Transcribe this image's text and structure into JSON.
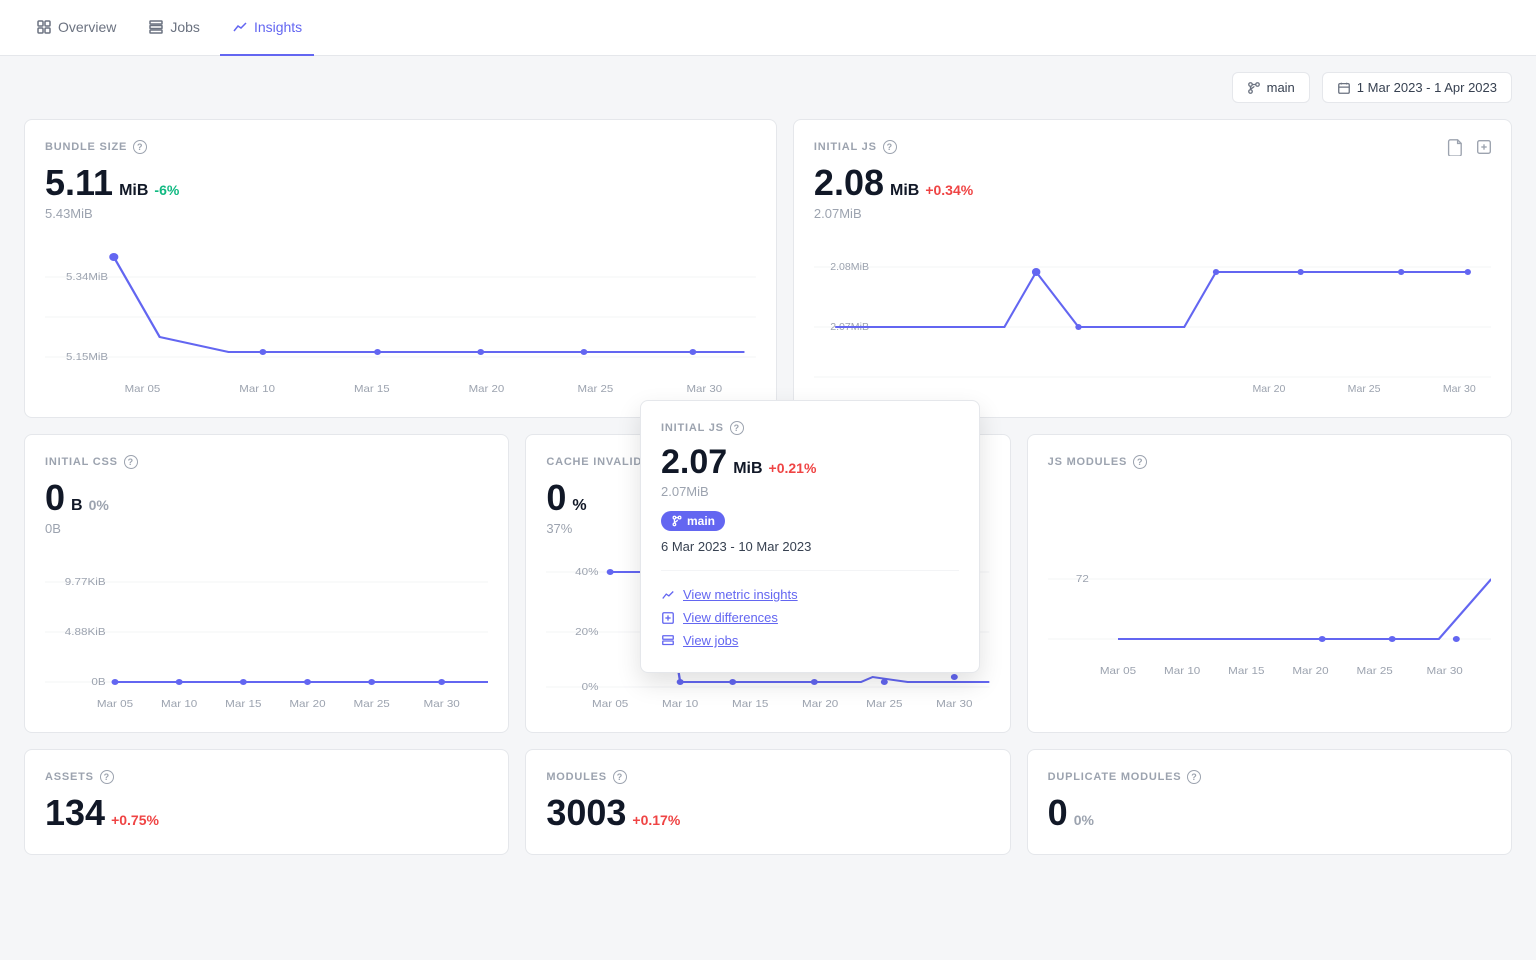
{
  "nav": {
    "items": [
      {
        "id": "overview",
        "label": "Overview",
        "active": false,
        "icon": "grid"
      },
      {
        "id": "jobs",
        "label": "Jobs",
        "active": false,
        "icon": "list"
      },
      {
        "id": "insights",
        "label": "Insights",
        "active": true,
        "icon": "chart-line"
      }
    ]
  },
  "toolbar": {
    "branch": "main",
    "date_range": "1 Mar 2023 - 1 Apr 2023"
  },
  "cards": {
    "bundle_size": {
      "label": "BUNDLE SIZE",
      "value": "5.11",
      "unit": "MiB",
      "change": "-6%",
      "change_type": "negative",
      "prev": "5.43MiB",
      "y_labels": [
        "5.34MiB",
        "5.15MiB"
      ],
      "x_labels": [
        "Mar 05",
        "Mar 10",
        "Mar 15",
        "Mar 20",
        "Mar 25",
        "Mar 30"
      ]
    },
    "initial_js": {
      "label": "INITIAL JS",
      "value": "2.08",
      "unit": "MiB",
      "change": "+0.34%",
      "change_type": "positive",
      "prev": "2.07MiB",
      "y_labels": [
        "2.08MiB",
        "2.07MiB"
      ],
      "x_labels": [
        "Mar 20",
        "Mar 25",
        "Mar 30"
      ]
    },
    "initial_css": {
      "label": "INITIAL CSS",
      "value": "0",
      "unit": "B",
      "change": "0%",
      "change_type": "neutral",
      "prev": "0B",
      "y_labels": [
        "9.77KiB",
        "4.88KiB",
        "0B"
      ],
      "x_labels": [
        "Mar 05",
        "Mar 10",
        "Mar 15",
        "Mar 20",
        "Mar 25",
        "Mar 30"
      ]
    },
    "cache_invalidation": {
      "label": "CACHE INVALIDATION",
      "value": "0",
      "unit": "%",
      "change": "",
      "change_type": "neutral",
      "prev": "37%",
      "y_labels": [
        "40%",
        "20%",
        "0%"
      ],
      "x_labels": [
        "Mar 05",
        "Mar 10",
        "Mar 15",
        "Mar 20",
        "Mar 25",
        "Mar 30"
      ]
    },
    "js_modules": {
      "label": "JS MODULES",
      "value": "",
      "unit": "",
      "change": "",
      "change_type": "neutral",
      "prev": "",
      "y_labels": [
        "72"
      ],
      "x_labels": [
        "Mar 05",
        "Mar 10",
        "Mar 15",
        "Mar 20",
        "Mar 25",
        "Mar 30"
      ]
    },
    "assets": {
      "label": "ASSETS",
      "value": "134",
      "unit": "",
      "change": "+0.75%",
      "change_type": "positive",
      "prev": ""
    },
    "modules": {
      "label": "MODULES",
      "value": "3003",
      "unit": "",
      "change": "+0.17%",
      "change_type": "positive",
      "prev": ""
    },
    "duplicate_modules": {
      "label": "DUPLICATE MODULES",
      "value": "0",
      "unit": "",
      "change": "0%",
      "change_type": "neutral",
      "prev": ""
    }
  },
  "tooltip": {
    "title": "INITIAL JS",
    "value": "2.07",
    "unit": "MiB",
    "change": "+0.21%",
    "change_type": "positive",
    "prev": "2.07MiB",
    "branch": "main",
    "date_range": "6 Mar 2023 - 10 Mar 2023",
    "links": [
      {
        "id": "metric-insights",
        "label": "View metric insights",
        "icon": "chart"
      },
      {
        "id": "differences",
        "label": "View differences",
        "icon": "diff"
      },
      {
        "id": "jobs",
        "label": "View jobs",
        "icon": "list"
      }
    ]
  }
}
